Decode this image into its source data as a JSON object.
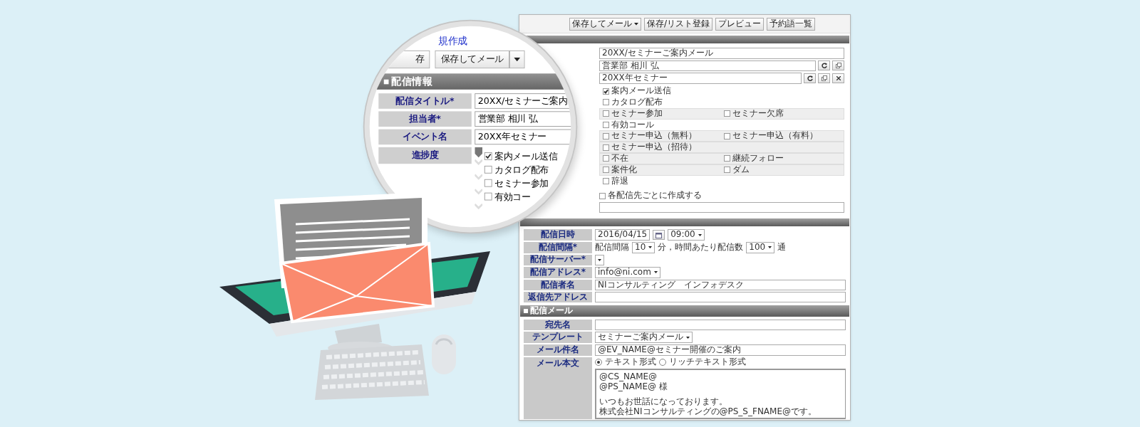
{
  "magnifier": {
    "link": "規作成",
    "buttons": [
      {
        "label": "存",
        "kind": "plain"
      },
      {
        "label": "保存してメール",
        "kind": "split"
      }
    ],
    "section_title": "配信情報",
    "fields": [
      {
        "label": "配信タイトル*",
        "value": "20XX/セミナーご案内"
      },
      {
        "label": "担当者*",
        "value": "営業部 相川 弘"
      },
      {
        "label": "イベント名",
        "value": "20XX年セミナー"
      }
    ],
    "progress_label": "進捗度",
    "progress": [
      {
        "label": "案内メール送信",
        "checked": true
      },
      {
        "label": "カタログ配布",
        "checked": false
      },
      {
        "label": "セミナー参加",
        "checked": false
      },
      {
        "label": "有効コー",
        "checked": false
      }
    ]
  },
  "panel": {
    "toolbar": [
      {
        "label": "保存してメール",
        "kind": "split"
      },
      {
        "label": "保存/リスト登録",
        "kind": "plain"
      },
      {
        "label": "プレビュー",
        "kind": "plain"
      },
      {
        "label": "予約語一覧",
        "kind": "plain"
      }
    ],
    "info_fields": [
      {
        "value": "20XX/セミナーご案内メール",
        "kind": "plain"
      },
      {
        "value": "営業部 相川 弘",
        "kind": "pick"
      },
      {
        "value": "20XX年セミナー",
        "kind": "pick_clear"
      }
    ],
    "progress_rows": [
      {
        "shaded": false,
        "items": [
          {
            "label": "案内メール送信",
            "checked": true
          }
        ]
      },
      {
        "shaded": false,
        "items": [
          {
            "label": "カタログ配布",
            "checked": false
          }
        ]
      },
      {
        "shaded": true,
        "items": [
          {
            "label": "セミナー参加",
            "checked": false
          },
          {
            "label": "セミナー欠席",
            "checked": false
          }
        ]
      },
      {
        "shaded": false,
        "items": [
          {
            "label": "有効コール",
            "checked": false
          }
        ]
      },
      {
        "shaded": true,
        "items": [
          {
            "label": "セミナー申込（無料）",
            "checked": false
          },
          {
            "label": "セミナー申込（有料）",
            "checked": false
          }
        ]
      },
      {
        "shaded": true,
        "items": [
          {
            "label": "セミナー申込（招待）",
            "checked": false
          }
        ]
      },
      {
        "shaded": true,
        "items": [
          {
            "label": "不在",
            "checked": false
          },
          {
            "label": "継続フォロー",
            "checked": false
          }
        ]
      },
      {
        "shaded": true,
        "items": [
          {
            "label": "案件化",
            "checked": false
          },
          {
            "label": "ダム",
            "checked": false
          }
        ]
      },
      {
        "shaded": false,
        "items": [
          {
            "label": "辞退",
            "checked": false
          }
        ]
      }
    ],
    "per_recipient": {
      "label": "各配信先ごとに作成する",
      "checked": false
    },
    "delivery_fields": [
      {
        "label": "配信日時",
        "kind": "datetime",
        "date": "2016/04/15",
        "time": "09:00"
      },
      {
        "label": "配信間隔*",
        "kind": "interval",
        "text_1": "配信間隔",
        "interval": "10",
        "text_2": "分，時間あたり配信数",
        "count": "100",
        "text_3": "通"
      },
      {
        "label": "配信サーバー*",
        "kind": "select"
      },
      {
        "label": "配信アドレス*",
        "kind": "select",
        "value": "info@ni.com"
      },
      {
        "label": "配信者名",
        "kind": "text",
        "value": "NIコンサルティング　インフォデスク"
      },
      {
        "label": "返信先アドレス",
        "kind": "text"
      }
    ],
    "mail_section": {
      "title": "配信メール",
      "fields": [
        {
          "label": "宛先名",
          "kind": "text"
        },
        {
          "label": "テンプレート",
          "kind": "select",
          "value": "セミナーご案内メール"
        },
        {
          "label": "メール件名",
          "kind": "text",
          "value": "@EV_NAME@セミナー開催のご案内"
        },
        {
          "label": "メール本文",
          "kind": "body",
          "formats": [
            {
              "label": "テキスト形式",
              "selected": true
            },
            {
              "label": "リッチテキスト形式",
              "selected": false
            }
          ],
          "paragraphs": [
            [
              "@CS_NAME@",
              "@PS_NAME@ 様"
            ],
            [
              "いつもお世話になっております。",
              "株式会社NIコンサルティングの@PS_S_FNAME@です。"
            ]
          ]
        }
      ]
    }
  }
}
